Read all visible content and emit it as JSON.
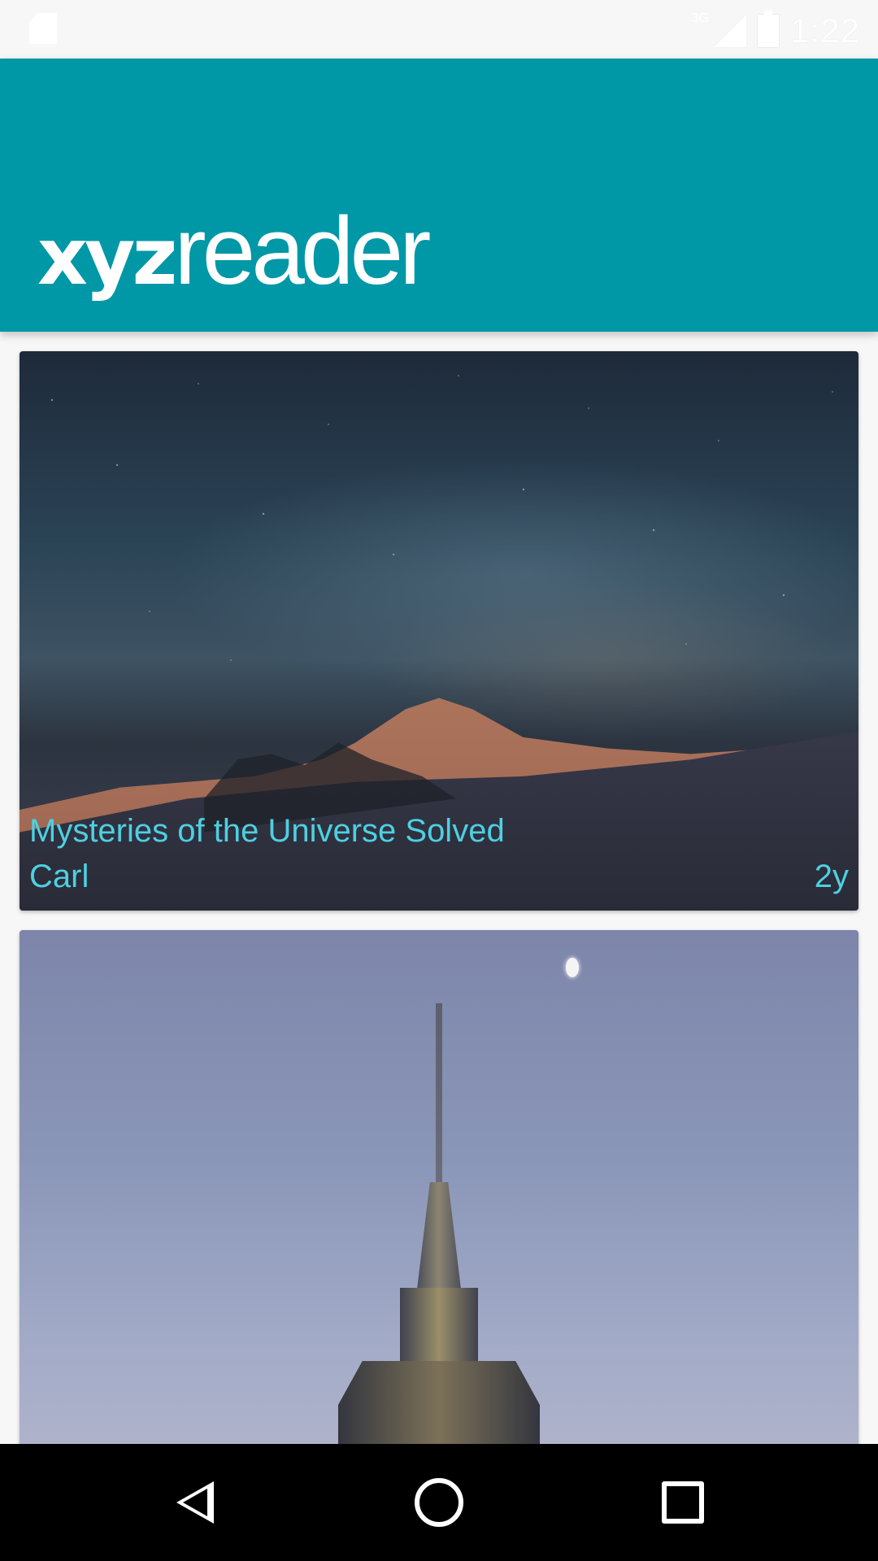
{
  "status_bar": {
    "network_type": "3G",
    "time": "1:22",
    "icons": [
      "sd-card-icon",
      "signal-icon",
      "battery-icon"
    ]
  },
  "app_bar": {
    "logo_bold": "xyz",
    "logo_light": "reader",
    "color": "#0097a7"
  },
  "articles": [
    {
      "title": "Mysteries of the Universe Solved",
      "author": "Carl",
      "age": "2y",
      "image": "night-sky-mountain-photo"
    },
    {
      "title": "",
      "author": "",
      "age": "",
      "image": "skyscraper-dusk-photo"
    }
  ],
  "theme": {
    "accent_text": "#4dd0e1",
    "background": "#f7f7f7"
  },
  "nav_bar": {
    "icons": [
      "back-icon",
      "home-icon",
      "recents-icon"
    ]
  }
}
